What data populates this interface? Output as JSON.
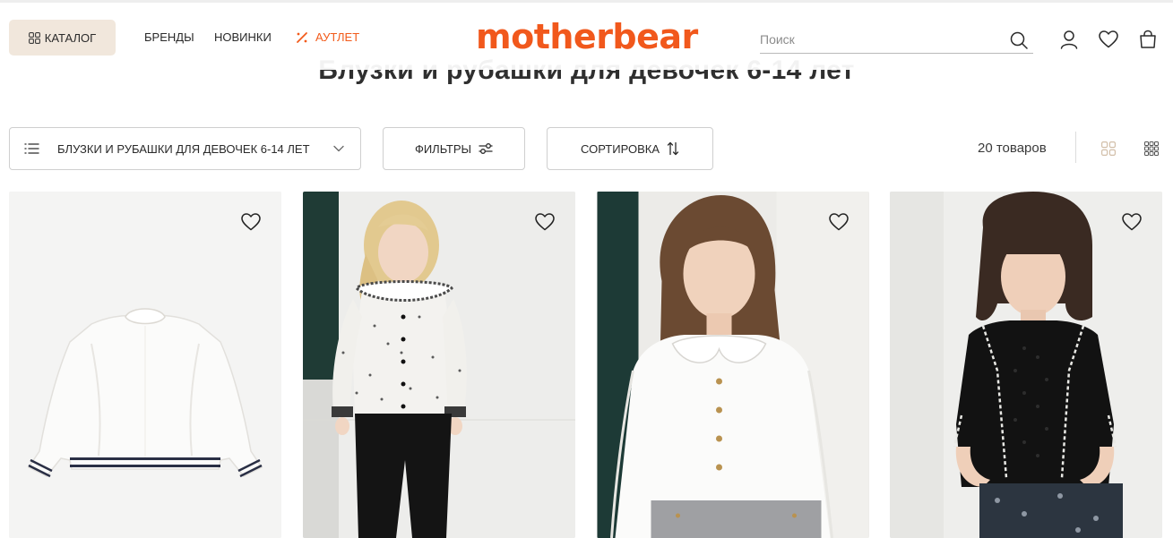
{
  "header": {
    "catalog_label": "КАТАЛОГ",
    "nav": {
      "brands": "БРЕНДЫ",
      "new": "НОВИНКИ",
      "outlet": "АУТЛЕТ"
    },
    "logo_text": "motherbear",
    "search_placeholder": "Поиск",
    "colors": {
      "brand": "#f1581c",
      "outlet": "#f25b1b",
      "catalog_bg": "#f1e7dc"
    }
  },
  "page": {
    "title": "Блузки и рубашки для девочек 6-14 лет"
  },
  "toolbar": {
    "category_select": "БЛУЗКИ И РУБАШКИ ДЛЯ ДЕВОЧЕК 6-14 ЛЕТ",
    "filters_label": "ФИЛЬТРЫ",
    "sort_label": "СОРТИРОВКА",
    "count_text": "20 товаров",
    "active_view": "grid-large",
    "view_colors": {
      "active": "#d2bfa9",
      "inactive": "#555555"
    }
  },
  "products": [
    {
      "image": "white ruffle-collar blouse with navy striped cuffs",
      "favorite": false
    },
    {
      "image": "girl in floral blouse with smocked collar and black trousers",
      "favorite": false
    },
    {
      "image": "girl in white blouse with peter-pan collar and gold buttons",
      "favorite": false
    },
    {
      "image": "girl in black crochet cardigan",
      "favorite": false
    }
  ],
  "icons": {
    "catalog": "grid-icon",
    "outlet": "percent-icon",
    "search": "search-icon",
    "account": "user-icon",
    "favorites": "heart-icon",
    "cart": "bag-icon",
    "category": "list-icon",
    "chevron": "chevron-down-icon",
    "filters": "filters-icon",
    "sort": "sort-icon",
    "view_large": "grid-4-icon",
    "view_small": "grid-9-icon"
  }
}
